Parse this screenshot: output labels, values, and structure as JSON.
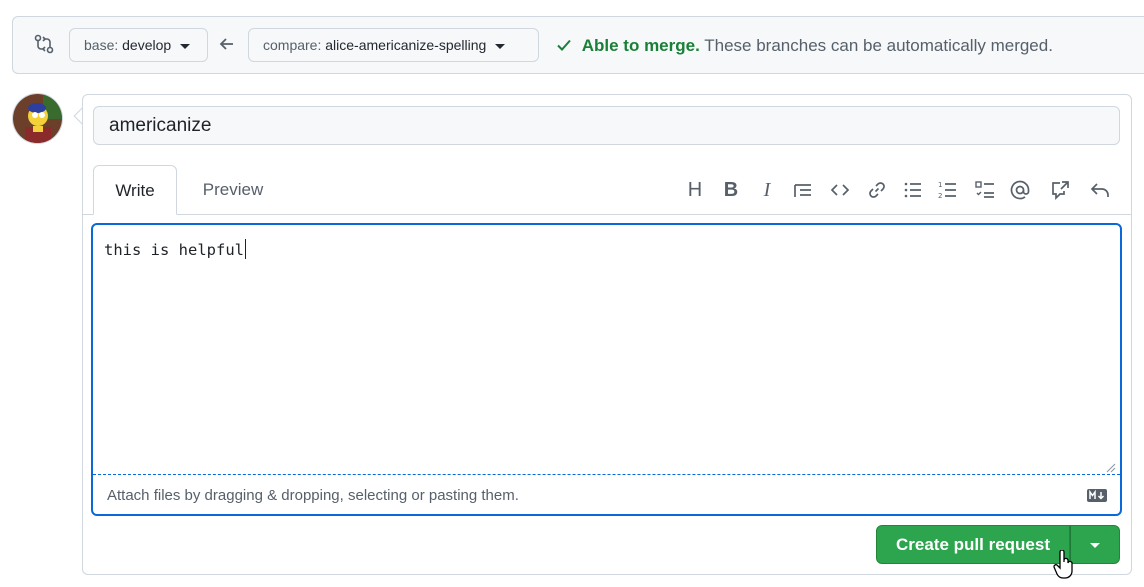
{
  "compare": {
    "base_prefix": "base:",
    "base_branch": "develop",
    "compare_prefix": "compare:",
    "compare_branch": "alice-americanize-spelling",
    "merge_ok": "Able to merge.",
    "merge_desc": "These branches can be automatically merged."
  },
  "form": {
    "title_value": "americanize",
    "tabs": [
      {
        "label": "Write",
        "active": true
      },
      {
        "label": "Preview",
        "active": false
      }
    ],
    "toolbar": {
      "heading": "H",
      "bold": "B",
      "italic": "I"
    },
    "body_value": "this is helpful",
    "attach_text": "Attach files by dragging & dropping, selecting or pasting them."
  },
  "actions": {
    "create_label": "Create pull request"
  },
  "colors": {
    "accent_blue": "#0969da",
    "success_green": "#2da44e",
    "merge_green": "#1a7f37"
  },
  "icons": [
    "git-compare-icon",
    "arrow-left-icon",
    "check-icon",
    "heading-icon",
    "bold-icon",
    "italic-icon",
    "quote-icon",
    "code-icon",
    "link-icon",
    "bullet-list-icon",
    "numbered-list-icon",
    "task-list-icon",
    "mention-icon",
    "cross-reference-icon",
    "reply-icon",
    "markdown-icon",
    "chevron-down-icon"
  ]
}
